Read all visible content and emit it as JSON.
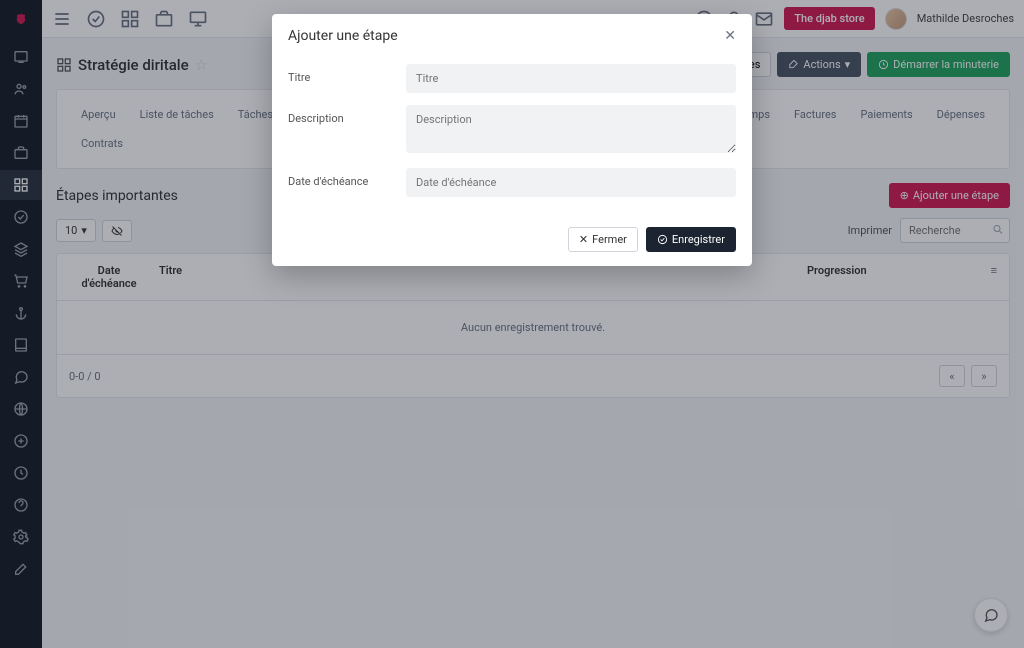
{
  "topbar": {
    "store_label": "The djab store",
    "username": "Mathilde Desroches"
  },
  "page": {
    "title": "Stratégie diritale"
  },
  "page_actions": {
    "settings": "Paramètres",
    "actions": "Actions",
    "start_timer": "Démarrer la minuterie"
  },
  "tabs": {
    "row1": {
      "apercu": "Aperçu",
      "liste": "Liste de tâches",
      "kanban": "Tâches Kanban",
      "temps": "e temps",
      "factures": "Factures",
      "paiements": "Paiements",
      "depenses": "Dépenses"
    },
    "row2": {
      "contrats": "Contrats"
    }
  },
  "section": {
    "title": "Étapes importantes",
    "add_button": "Ajouter une étape",
    "page_size": "10",
    "print": "Imprimer",
    "search_placeholder": "Recherche"
  },
  "table": {
    "headers": {
      "date": "Date d'échéance",
      "title": "Titre",
      "progress": "Progression"
    },
    "empty": "Aucun enregistrement trouvé.",
    "footer_count": "0-0 / 0"
  },
  "modal": {
    "title": "Ajouter une étape",
    "fields": {
      "title_label": "Titre",
      "title_placeholder": "Titre",
      "desc_label": "Description",
      "desc_placeholder": "Description",
      "due_label": "Date d'échéance",
      "due_placeholder": "Date d'échéance"
    },
    "buttons": {
      "close": "Fermer",
      "save": "Enregistrer"
    }
  }
}
